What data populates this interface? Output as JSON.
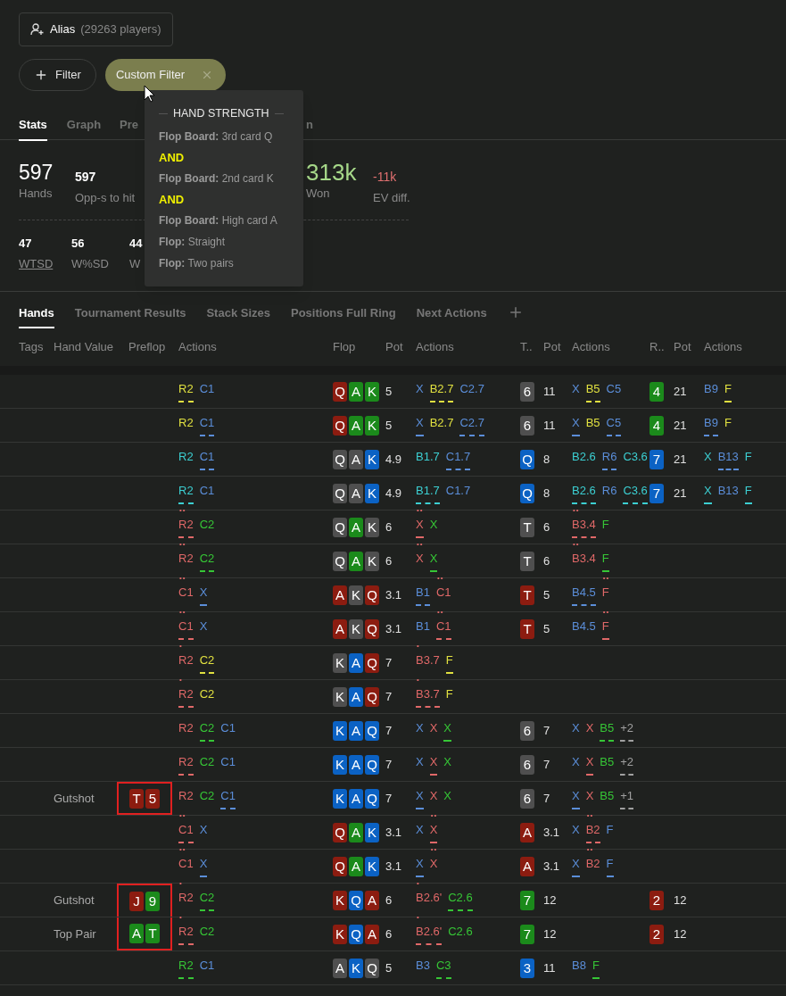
{
  "alias": {
    "name": "Alias",
    "count": "(29263 players)"
  },
  "filters": {
    "add_label": "Filter",
    "chip_label": "Custom Filter"
  },
  "tabs": [
    {
      "label": "Stats",
      "selected": true
    },
    {
      "label": "Graph",
      "selected": false
    },
    {
      "label": "Pre",
      "selected": false
    },
    {
      "label": "n",
      "selected": false
    }
  ],
  "stats": [
    {
      "value": "597",
      "label": "Hands",
      "kind": "primary"
    },
    {
      "value": "597",
      "label": "Opp-s to hit",
      "kind": "secondary"
    },
    {
      "value": "313k",
      "label": "Won",
      "kind": "positive"
    },
    {
      "value": "-11k",
      "label": "EV diff.",
      "kind": "negative"
    }
  ],
  "stats_secondary": [
    {
      "value": "47",
      "label": "WTSD",
      "link": true
    },
    {
      "value": "56",
      "label": "W%SD",
      "link": false
    },
    {
      "value": "44",
      "label": "W",
      "link": false
    }
  ],
  "tooltip": {
    "title": "HAND STRENGTH",
    "lines": [
      {
        "kind": "condition",
        "label": "Flop Board:",
        "value": "3rd card Q"
      },
      {
        "kind": "operator",
        "text": "AND"
      },
      {
        "kind": "condition",
        "label": "Flop Board:",
        "value": "2nd card K"
      },
      {
        "kind": "operator",
        "text": "AND"
      },
      {
        "kind": "condition",
        "label": "Flop Board:",
        "value": "High card A"
      },
      {
        "kind": "condition",
        "label": "Flop:",
        "value": "Straight"
      },
      {
        "kind": "condition",
        "label": "Flop:",
        "value": "Two pairs"
      }
    ]
  },
  "table_tabs": [
    {
      "label": "Hands",
      "selected": true
    },
    {
      "label": "Tournament Results",
      "selected": false
    },
    {
      "label": "Stack Sizes",
      "selected": false
    },
    {
      "label": "Positions Full Ring",
      "selected": false
    },
    {
      "label": "Next Actions",
      "selected": false
    }
  ],
  "columns": [
    "Tags",
    "Hand Value",
    "Preflop",
    "Actions",
    "Flop",
    "Pot",
    "Actions",
    "T..",
    "Pot",
    "Actions",
    "R..",
    "Pot",
    "Actions"
  ],
  "rows": [
    {
      "preflop": [
        {
          "text": "R2",
          "color": "#e0e040",
          "underlined": true
        },
        {
          "text": "C1",
          "color": "#5b8ed9",
          "underlined": false
        }
      ],
      "flop": {
        "cards": [
          {
            "rank": "Q",
            "color": "#8c1c10"
          },
          {
            "rank": "A",
            "color": "#1b8a1b"
          },
          {
            "rank": "K",
            "color": "#1b8a1b"
          }
        ],
        "pot": "5",
        "actions": [
          {
            "text": "X",
            "color": "#5b8ed9",
            "underlined": false
          },
          {
            "text": "B2.7",
            "color": "#e0e040",
            "underlined": true
          },
          {
            "text": "C2.7",
            "color": "#5b8ed9",
            "underlined": false
          }
        ]
      },
      "turn": {
        "cards": [
          {
            "rank": "6",
            "color": "#4f4f4f"
          }
        ],
        "pot": "11",
        "actions": [
          {
            "text": "X",
            "color": "#5b8ed9",
            "underlined": false
          },
          {
            "text": "B5",
            "color": "#e0e040",
            "underlined": true
          },
          {
            "text": "C5",
            "color": "#5b8ed9",
            "underlined": false
          }
        ]
      },
      "river": {
        "cards": [
          {
            "rank": "4",
            "color": "#1b8a1b"
          }
        ],
        "pot": "21",
        "actions": [
          {
            "text": "B9",
            "color": "#5b8ed9",
            "underlined": false
          },
          {
            "text": "F",
            "color": "#e0e040",
            "underlined": true
          }
        ]
      }
    },
    {
      "preflop": [
        {
          "text": "R2",
          "color": "#e0e040",
          "underlined": false
        },
        {
          "text": "C1",
          "color": "#5b8ed9",
          "underlined": true
        }
      ],
      "flop": {
        "cards": [
          {
            "rank": "Q",
            "color": "#8c1c10"
          },
          {
            "rank": "A",
            "color": "#1b8a1b"
          },
          {
            "rank": "K",
            "color": "#1b8a1b"
          }
        ],
        "pot": "5",
        "actions": [
          {
            "text": "X",
            "color": "#5b8ed9",
            "underlined": true
          },
          {
            "text": "B2.7",
            "color": "#e0e040",
            "underlined": false
          },
          {
            "text": "C2.7",
            "color": "#5b8ed9",
            "underlined": true
          }
        ]
      },
      "turn": {
        "cards": [
          {
            "rank": "6",
            "color": "#4f4f4f"
          }
        ],
        "pot": "11",
        "actions": [
          {
            "text": "X",
            "color": "#5b8ed9",
            "underlined": true
          },
          {
            "text": "B5",
            "color": "#e0e040",
            "underlined": false
          },
          {
            "text": "C5",
            "color": "#5b8ed9",
            "underlined": true
          }
        ]
      },
      "river": {
        "cards": [
          {
            "rank": "4",
            "color": "#1b8a1b"
          }
        ],
        "pot": "21",
        "actions": [
          {
            "text": "B9",
            "color": "#5b8ed9",
            "underlined": true
          },
          {
            "text": "F",
            "color": "#e0e040",
            "underlined": false
          }
        ]
      }
    },
    {
      "preflop": [
        {
          "text": "R2",
          "color": "#3ccfd2",
          "underlined": false
        },
        {
          "text": "C1",
          "color": "#5b8ed9",
          "underlined": true
        }
      ],
      "flop": {
        "cards": [
          {
            "rank": "Q",
            "color": "#4f4f4f"
          },
          {
            "rank": "A",
            "color": "#4f4f4f"
          },
          {
            "rank": "K",
            "color": "#0b62c4"
          }
        ],
        "pot": "4.9",
        "actions": [
          {
            "text": "B1.7",
            "color": "#3ccfd2",
            "underlined": false
          },
          {
            "text": "C1.7",
            "color": "#5b8ed9",
            "underlined": true
          }
        ]
      },
      "turn": {
        "cards": [
          {
            "rank": "Q",
            "color": "#0b62c4"
          }
        ],
        "pot": "8",
        "actions": [
          {
            "text": "B2.6",
            "color": "#3ccfd2",
            "underlined": false
          },
          {
            "text": "R6",
            "color": "#5b8ed9",
            "underlined": true
          },
          {
            "text": "C3.6",
            "color": "#3ccfd2",
            "underlined": false
          }
        ]
      },
      "river": {
        "cards": [
          {
            "rank": "7",
            "color": "#0b62c4"
          }
        ],
        "pot": "21",
        "actions": [
          {
            "text": "X",
            "color": "#3ccfd2",
            "underlined": false
          },
          {
            "text": "B13",
            "color": "#5b8ed9",
            "underlined": true
          },
          {
            "text": "F",
            "color": "#3ccfd2",
            "underlined": false
          }
        ]
      }
    },
    {
      "preflop": [
        {
          "text": "R2",
          "color": "#3ccfd2",
          "underlined": true
        },
        {
          "text": "C1",
          "color": "#5b8ed9",
          "underlined": false
        }
      ],
      "flop": {
        "cards": [
          {
            "rank": "Q",
            "color": "#4f4f4f"
          },
          {
            "rank": "A",
            "color": "#4f4f4f"
          },
          {
            "rank": "K",
            "color": "#0b62c4"
          }
        ],
        "pot": "4.9",
        "actions": [
          {
            "text": "B1.7",
            "color": "#3ccfd2",
            "underlined": true
          },
          {
            "text": "C1.7",
            "color": "#5b8ed9",
            "underlined": false
          }
        ]
      },
      "turn": {
        "cards": [
          {
            "rank": "Q",
            "color": "#0b62c4"
          }
        ],
        "pot": "8",
        "actions": [
          {
            "text": "B2.6",
            "color": "#3ccfd2",
            "underlined": true
          },
          {
            "text": "R6",
            "color": "#5b8ed9",
            "underlined": false
          },
          {
            "text": "C3.6",
            "color": "#3ccfd2",
            "underlined": true
          }
        ]
      },
      "river": {
        "cards": [
          {
            "rank": "7",
            "color": "#0b62c4"
          }
        ],
        "pot": "21",
        "actions": [
          {
            "text": "X",
            "color": "#3ccfd2",
            "underlined": true
          },
          {
            "text": "B13",
            "color": "#5b8ed9",
            "underlined": false
          },
          {
            "text": "F",
            "color": "#3ccfd2",
            "underlined": true
          }
        ]
      }
    },
    {
      "preflop": [
        {
          "text": "R2",
          "color": "#e06868",
          "underlined": true,
          "dots": "••"
        },
        {
          "text": "C2",
          "color": "#36c636",
          "underlined": false
        }
      ],
      "flop": {
        "cards": [
          {
            "rank": "Q",
            "color": "#4f4f4f"
          },
          {
            "rank": "A",
            "color": "#1b8a1b"
          },
          {
            "rank": "K",
            "color": "#4f4f4f"
          }
        ],
        "pot": "6",
        "actions": [
          {
            "text": "X",
            "color": "#e06868",
            "underlined": true,
            "dots": "••"
          },
          {
            "text": "X",
            "color": "#36c636",
            "underlined": false
          }
        ]
      },
      "turn": {
        "cards": [
          {
            "rank": "T",
            "color": "#4f4f4f"
          }
        ],
        "pot": "6",
        "actions": [
          {
            "text": "B3.4",
            "color": "#e06868",
            "underlined": true,
            "dots": "••"
          },
          {
            "text": "F",
            "color": "#36c636",
            "underlined": false
          }
        ]
      }
    },
    {
      "preflop": [
        {
          "text": "R2",
          "color": "#e06868",
          "underlined": false,
          "dots": "••"
        },
        {
          "text": "C2",
          "color": "#36c636",
          "underlined": true
        }
      ],
      "flop": {
        "cards": [
          {
            "rank": "Q",
            "color": "#4f4f4f"
          },
          {
            "rank": "A",
            "color": "#1b8a1b"
          },
          {
            "rank": "K",
            "color": "#4f4f4f"
          }
        ],
        "pot": "6",
        "actions": [
          {
            "text": "X",
            "color": "#e06868",
            "underlined": false,
            "dots": "••"
          },
          {
            "text": "X",
            "color": "#36c636",
            "underlined": true
          }
        ]
      },
      "turn": {
        "cards": [
          {
            "rank": "T",
            "color": "#4f4f4f"
          }
        ],
        "pot": "6",
        "actions": [
          {
            "text": "B3.4",
            "color": "#e06868",
            "underlined": false,
            "dots": "••"
          },
          {
            "text": "F",
            "color": "#36c636",
            "underlined": true
          }
        ]
      }
    },
    {
      "preflop": [
        {
          "text": "C1",
          "color": "#e06868",
          "underlined": false,
          "dots": "••"
        },
        {
          "text": "X",
          "color": "#5b8ed9",
          "underlined": true
        }
      ],
      "flop": {
        "cards": [
          {
            "rank": "A",
            "color": "#8c1c10"
          },
          {
            "rank": "K",
            "color": "#4f4f4f"
          },
          {
            "rank": "Q",
            "color": "#8c1c10"
          }
        ],
        "pot": "3.1",
        "actions": [
          {
            "text": "B1",
            "color": "#5b8ed9",
            "underlined": true
          },
          {
            "text": "C1",
            "color": "#e06868",
            "underlined": false,
            "dots": "••"
          }
        ]
      },
      "turn": {
        "cards": [
          {
            "rank": "T",
            "color": "#8c1c10"
          }
        ],
        "pot": "5",
        "actions": [
          {
            "text": "B4.5",
            "color": "#5b8ed9",
            "underlined": true
          },
          {
            "text": "F",
            "color": "#e06868",
            "underlined": false,
            "dots": "••"
          }
        ]
      }
    },
    {
      "preflop": [
        {
          "text": "C1",
          "color": "#e06868",
          "underlined": true,
          "dots": "••"
        },
        {
          "text": "X",
          "color": "#5b8ed9",
          "underlined": false
        }
      ],
      "flop": {
        "cards": [
          {
            "rank": "A",
            "color": "#8c1c10"
          },
          {
            "rank": "K",
            "color": "#4f4f4f"
          },
          {
            "rank": "Q",
            "color": "#8c1c10"
          }
        ],
        "pot": "3.1",
        "actions": [
          {
            "text": "B1",
            "color": "#5b8ed9",
            "underlined": false
          },
          {
            "text": "C1",
            "color": "#e06868",
            "underlined": true,
            "dots": "••"
          }
        ]
      },
      "turn": {
        "cards": [
          {
            "rank": "T",
            "color": "#8c1c10"
          }
        ],
        "pot": "5",
        "actions": [
          {
            "text": "B4.5",
            "color": "#5b8ed9",
            "underlined": false
          },
          {
            "text": "F",
            "color": "#e06868",
            "underlined": true,
            "dots": "••"
          }
        ]
      }
    },
    {
      "preflop": [
        {
          "text": "R2",
          "color": "#e06868",
          "underlined": false,
          "dots": "•"
        },
        {
          "text": "C2",
          "color": "#e0e040",
          "underlined": true
        }
      ],
      "flop": {
        "cards": [
          {
            "rank": "K",
            "color": "#4f4f4f"
          },
          {
            "rank": "A",
            "color": "#0b62c4"
          },
          {
            "rank": "Q",
            "color": "#8c1c10"
          }
        ],
        "pot": "7",
        "actions": [
          {
            "text": "B3.7",
            "color": "#e06868",
            "underlined": false,
            "dots": "•"
          },
          {
            "text": "F",
            "color": "#e0e040",
            "underlined": true
          }
        ]
      }
    },
    {
      "preflop": [
        {
          "text": "R2",
          "color": "#e06868",
          "underlined": true,
          "dots": "•"
        },
        {
          "text": "C2",
          "color": "#e0e040",
          "underlined": false
        }
      ],
      "flop": {
        "cards": [
          {
            "rank": "K",
            "color": "#4f4f4f"
          },
          {
            "rank": "A",
            "color": "#0b62c4"
          },
          {
            "rank": "Q",
            "color": "#8c1c10"
          }
        ],
        "pot": "7",
        "actions": [
          {
            "text": "B3.7",
            "color": "#e06868",
            "underlined": true,
            "dots": "•"
          },
          {
            "text": "F",
            "color": "#e0e040",
            "underlined": false
          }
        ]
      }
    },
    {
      "preflop": [
        {
          "text": "R2",
          "color": "#e06868",
          "underlined": false
        },
        {
          "text": "C2",
          "color": "#36c636",
          "underlined": true
        },
        {
          "text": "C1",
          "color": "#5b8ed9",
          "underlined": false
        }
      ],
      "flop": {
        "cards": [
          {
            "rank": "K",
            "color": "#0b62c4"
          },
          {
            "rank": "A",
            "color": "#0b62c4"
          },
          {
            "rank": "Q",
            "color": "#0b62c4"
          }
        ],
        "pot": "7",
        "actions": [
          {
            "text": "X",
            "color": "#5b8ed9",
            "underlined": false
          },
          {
            "text": "X",
            "color": "#e06868",
            "underlined": false
          },
          {
            "text": "X",
            "color": "#36c636",
            "underlined": true
          }
        ]
      },
      "turn": {
        "cards": [
          {
            "rank": "6",
            "color": "#4f4f4f"
          }
        ],
        "pot": "7",
        "actions": [
          {
            "text": "X",
            "color": "#5b8ed9",
            "underlined": false
          },
          {
            "text": "X",
            "color": "#e06868",
            "underlined": false
          },
          {
            "text": "B5",
            "color": "#36c636",
            "underlined": true
          },
          {
            "text": "+2",
            "color": "#a0a0a0",
            "underlined": true
          }
        ]
      }
    },
    {
      "preflop": [
        {
          "text": "R2",
          "color": "#e06868",
          "underlined": true
        },
        {
          "text": "C2",
          "color": "#36c636",
          "underlined": false
        },
        {
          "text": "C1",
          "color": "#5b8ed9",
          "underlined": false
        }
      ],
      "flop": {
        "cards": [
          {
            "rank": "K",
            "color": "#0b62c4"
          },
          {
            "rank": "A",
            "color": "#0b62c4"
          },
          {
            "rank": "Q",
            "color": "#0b62c4"
          }
        ],
        "pot": "7",
        "actions": [
          {
            "text": "X",
            "color": "#5b8ed9",
            "underlined": false
          },
          {
            "text": "X",
            "color": "#e06868",
            "underlined": true
          },
          {
            "text": "X",
            "color": "#36c636",
            "underlined": false
          }
        ]
      },
      "turn": {
        "cards": [
          {
            "rank": "6",
            "color": "#4f4f4f"
          }
        ],
        "pot": "7",
        "actions": [
          {
            "text": "X",
            "color": "#5b8ed9",
            "underlined": false
          },
          {
            "text": "X",
            "color": "#e06868",
            "underlined": true
          },
          {
            "text": "B5",
            "color": "#36c636",
            "underlined": false
          },
          {
            "text": "+2",
            "color": "#a0a0a0",
            "underlined": true
          }
        ]
      }
    },
    {
      "hand_value": "Gutshot",
      "hole_cards": [
        {
          "rank": "T",
          "color": "#8c1c10"
        },
        {
          "rank": "5",
          "color": "#8c1c10"
        }
      ],
      "boxed": true,
      "preflop": [
        {
          "text": "R2",
          "color": "#e06868",
          "underlined": false
        },
        {
          "text": "C2",
          "color": "#36c636",
          "underlined": false
        },
        {
          "text": "C1",
          "color": "#5b8ed9",
          "underlined": true
        }
      ],
      "flop": {
        "cards": [
          {
            "rank": "K",
            "color": "#0b62c4"
          },
          {
            "rank": "A",
            "color": "#0b62c4"
          },
          {
            "rank": "Q",
            "color": "#0b62c4"
          }
        ],
        "pot": "7",
        "actions": [
          {
            "text": "X",
            "color": "#5b8ed9",
            "underlined": true
          },
          {
            "text": "X",
            "color": "#e06868",
            "underlined": false
          },
          {
            "text": "X",
            "color": "#36c636",
            "underlined": false
          }
        ]
      },
      "turn": {
        "cards": [
          {
            "rank": "6",
            "color": "#4f4f4f"
          }
        ],
        "pot": "7",
        "actions": [
          {
            "text": "X",
            "color": "#5b8ed9",
            "underlined": true
          },
          {
            "text": "X",
            "color": "#e06868",
            "underlined": false
          },
          {
            "text": "B5",
            "color": "#36c636",
            "underlined": false
          },
          {
            "text": "+1",
            "color": "#a0a0a0",
            "underlined": true
          }
        ]
      }
    },
    {
      "preflop": [
        {
          "text": "C1",
          "color": "#e06868",
          "underlined": true,
          "dots": "••"
        },
        {
          "text": "X",
          "color": "#5b8ed9",
          "underlined": false
        }
      ],
      "flop": {
        "cards": [
          {
            "rank": "Q",
            "color": "#8c1c10"
          },
          {
            "rank": "A",
            "color": "#1b8a1b"
          },
          {
            "rank": "K",
            "color": "#0b62c4"
          }
        ],
        "pot": "3.1",
        "actions": [
          {
            "text": "X",
            "color": "#5b8ed9",
            "underlined": false
          },
          {
            "text": "X",
            "color": "#e06868",
            "underlined": true,
            "dots": "••"
          }
        ]
      },
      "turn": {
        "cards": [
          {
            "rank": "A",
            "color": "#8c1c10"
          }
        ],
        "pot": "3.1",
        "actions": [
          {
            "text": "X",
            "color": "#5b8ed9",
            "underlined": false
          },
          {
            "text": "B2",
            "color": "#e06868",
            "underlined": true,
            "dots": "••"
          },
          {
            "text": "F",
            "color": "#5b8ed9",
            "underlined": false
          }
        ]
      }
    },
    {
      "preflop": [
        {
          "text": "C1",
          "color": "#e06868",
          "underlined": false,
          "dots": "••"
        },
        {
          "text": "X",
          "color": "#5b8ed9",
          "underlined": true
        }
      ],
      "flop": {
        "cards": [
          {
            "rank": "Q",
            "color": "#8c1c10"
          },
          {
            "rank": "A",
            "color": "#1b8a1b"
          },
          {
            "rank": "K",
            "color": "#0b62c4"
          }
        ],
        "pot": "3.1",
        "actions": [
          {
            "text": "X",
            "color": "#5b8ed9",
            "underlined": true
          },
          {
            "text": "X",
            "color": "#e06868",
            "underlined": false,
            "dots": "••"
          }
        ]
      },
      "turn": {
        "cards": [
          {
            "rank": "A",
            "color": "#8c1c10"
          }
        ],
        "pot": "3.1",
        "actions": [
          {
            "text": "X",
            "color": "#5b8ed9",
            "underlined": true
          },
          {
            "text": "B2",
            "color": "#e06868",
            "underlined": false,
            "dots": "••"
          },
          {
            "text": "F",
            "color": "#5b8ed9",
            "underlined": true
          }
        ]
      }
    },
    {
      "hand_value": "Gutshot",
      "hole_cards": [
        {
          "rank": "J",
          "color": "#8c1c10"
        },
        {
          "rank": "9",
          "color": "#1b8a1b"
        }
      ],
      "boxed": true,
      "preflop": [
        {
          "text": "R2",
          "color": "#e06868",
          "underlined": false,
          "dots": "•"
        },
        {
          "text": "C2",
          "color": "#36c636",
          "underlined": true
        }
      ],
      "flop": {
        "cards": [
          {
            "rank": "K",
            "color": "#8c1c10"
          },
          {
            "rank": "Q",
            "color": "#0b62c4"
          },
          {
            "rank": "A",
            "color": "#8c1c10"
          }
        ],
        "pot": "6",
        "actions": [
          {
            "text": "B2.6'",
            "color": "#e06868",
            "underlined": false,
            "dots": "•"
          },
          {
            "text": "C2.6",
            "color": "#36c636",
            "underlined": true
          }
        ]
      },
      "turn": {
        "cards": [
          {
            "rank": "7",
            "color": "#1b8a1b"
          }
        ],
        "pot": "12"
      },
      "river": {
        "cards": [
          {
            "rank": "2",
            "color": "#8c1c10"
          }
        ],
        "pot": "12"
      }
    },
    {
      "hand_value": "Top Pair",
      "hole_cards": [
        {
          "rank": "A",
          "color": "#1b8a1b"
        },
        {
          "rank": "T",
          "color": "#1b8a1b"
        }
      ],
      "boxed": true,
      "preflop": [
        {
          "text": "R2",
          "color": "#e06868",
          "underlined": true,
          "dots": "•"
        },
        {
          "text": "C2",
          "color": "#36c636",
          "underlined": false
        }
      ],
      "flop": {
        "cards": [
          {
            "rank": "K",
            "color": "#8c1c10"
          },
          {
            "rank": "Q",
            "color": "#0b62c4"
          },
          {
            "rank": "A",
            "color": "#8c1c10"
          }
        ],
        "pot": "6",
        "actions": [
          {
            "text": "B2.6'",
            "color": "#e06868",
            "underlined": true,
            "dots": "•"
          },
          {
            "text": "C2.6",
            "color": "#36c636",
            "underlined": false
          }
        ]
      },
      "turn": {
        "cards": [
          {
            "rank": "7",
            "color": "#1b8a1b"
          }
        ],
        "pot": "12"
      },
      "river": {
        "cards": [
          {
            "rank": "2",
            "color": "#8c1c10"
          }
        ],
        "pot": "12"
      }
    },
    {
      "preflop": [
        {
          "text": "R2",
          "color": "#36c636",
          "underlined": true
        },
        {
          "text": "C1",
          "color": "#5b8ed9",
          "underlined": false
        }
      ],
      "flop": {
        "cards": [
          {
            "rank": "A",
            "color": "#4f4f4f"
          },
          {
            "rank": "K",
            "color": "#0b62c4"
          },
          {
            "rank": "Q",
            "color": "#4f4f4f"
          }
        ],
        "pot": "5",
        "actions": [
          {
            "text": "B3",
            "color": "#5b8ed9",
            "underlined": false
          },
          {
            "text": "C3",
            "color": "#36c636",
            "underlined": true
          }
        ]
      },
      "turn": {
        "cards": [
          {
            "rank": "3",
            "color": "#0b62c4"
          }
        ],
        "pot": "11",
        "actions": [
          {
            "text": "B8",
            "color": "#5b8ed9",
            "underlined": false
          },
          {
            "text": "F",
            "color": "#36c636",
            "underlined": true
          }
        ]
      }
    }
  ]
}
